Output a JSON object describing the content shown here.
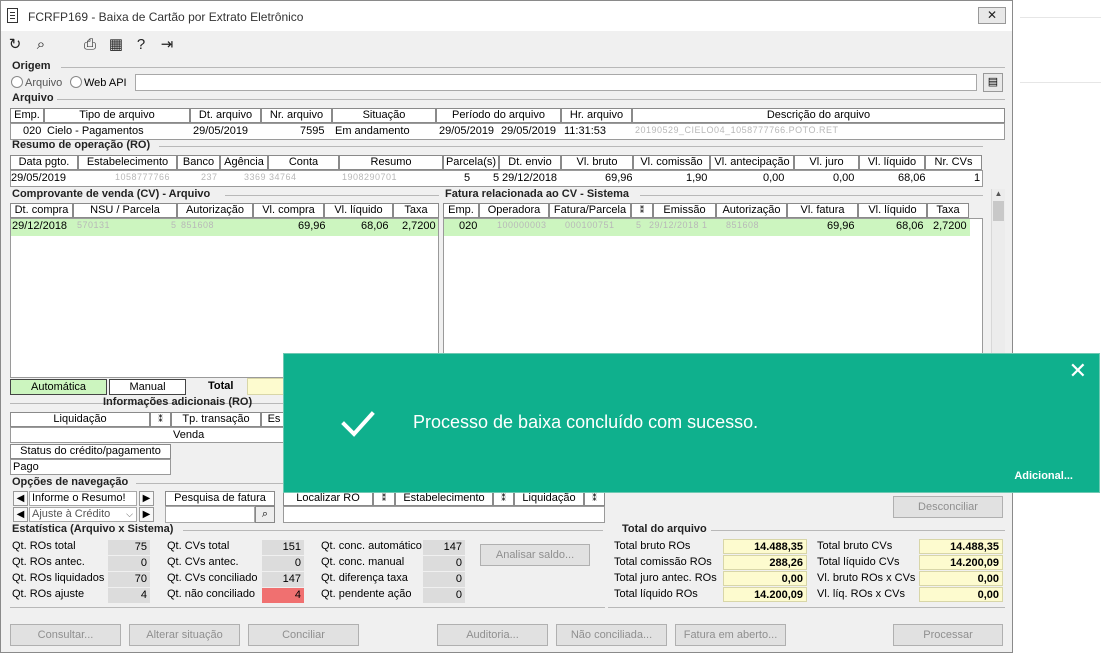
{
  "window": {
    "title": "FCRFP169 - Baixa de Cartão por Extrato Eletrônico",
    "close_glyph": "✕"
  },
  "toolbar": {
    "icons": [
      "refresh-icon",
      "search-icon",
      "print-icon",
      "calendar-icon",
      "help-icon",
      "exit-icon"
    ],
    "glyphs": {
      "refresh": "↻",
      "search": "⌕",
      "print": "⎙",
      "calendar": "▦",
      "help": "?",
      "exit": "⇥"
    }
  },
  "origem": {
    "title": "Origem",
    "opt1": "Arquivo",
    "opt2": "Web API",
    "path": ""
  },
  "arquivo": {
    "title": "Arquivo",
    "headers": [
      "Emp.",
      "Tipo de arquivo",
      "Dt. arquivo",
      "Nr. arquivo",
      "Situação",
      "Período do arquivo",
      "Hr. arquivo",
      "Descrição do arquivo"
    ],
    "row": {
      "emp": "020",
      "tipo": "Cielo - Pagamentos",
      "dt": "29/05/2019",
      "nr": "7595",
      "situacao": "Em andamento",
      "periodo_ini": "29/05/2019",
      "periodo_fim": "29/05/2019",
      "hr": "11:31:53",
      "descricao": "20190529_CIELO04_1058777766.POTO.RET"
    }
  },
  "resumo": {
    "title": "Resumo de operação (RO)",
    "headers": [
      "Data pgto.",
      "Estabelecimento",
      "Banco",
      "Agência",
      "Conta",
      "Resumo",
      "Parcela(s)",
      "Dt. envio",
      "Vl. bruto",
      "Vl. comissão",
      "Vl. antecipação",
      "Vl. juro",
      "Vl. líquido",
      "Nr. CVs"
    ],
    "row": {
      "data": "29/05/2019",
      "estab": "1058777766",
      "banco": "237",
      "agencia": "3369",
      "conta": "34764",
      "resumo": "1908290701",
      "parc1": "5",
      "parc2": "5",
      "envio": "29/12/2018",
      "bruto": "69,96",
      "comissao": "1,90",
      "antecip": "0,00",
      "juro": "0,00",
      "liquido": "68,06",
      "ncvs": "1"
    }
  },
  "cv": {
    "title": "Comprovante de venda (CV) - Arquivo",
    "headers": [
      "Dt. compra",
      "NSU / Parcela",
      "Autorização",
      "Vl. compra",
      "Vl. líquido",
      "Taxa"
    ],
    "row": {
      "dt": "29/12/2018",
      "nsu": "570131",
      "parc": "5",
      "aut": "851608",
      "compra": "69,96",
      "liquido": "68,06",
      "taxa": "2,7200"
    }
  },
  "fatura": {
    "title": "Fatura relacionada ao CV - Sistema",
    "headers": [
      "Emp.",
      "Operadora",
      "Fatura/Parcela",
      "",
      "Emissão",
      "Autorização",
      "Vl. fatura",
      "Vl. líquido",
      "Taxa"
    ],
    "row": {
      "emp": "020",
      "operadora": "100000003",
      "fatura": "000100751",
      "parc": "5",
      "emissao": "29/12/2018 1",
      "aut": "851608",
      "vfatura": "69,96",
      "liquido": "68,06",
      "taxa": "2,7200"
    }
  },
  "legend": {
    "auto": "Automática",
    "manual": "Manual",
    "total": "Total"
  },
  "info": {
    "title": "Informações adicionais (RO)",
    "liquidacao": "Liquidação",
    "tp_transacao": "Tp. transação",
    "es": "Es",
    "tp_value": "Venda",
    "status_title": "Status do crédito/pagamento",
    "status_value": "Pago"
  },
  "nav": {
    "title": "Opções de navegação",
    "informe": "Informe o Resumo!",
    "ajuste": "Ajuste à Crédito",
    "pesquisa": "Pesquisa de fatura",
    "localizar": "Localizar RO",
    "estabelecimento": "Estabelecimento",
    "liquidacao": "Liquidação"
  },
  "desconciliar": "Desconciliar",
  "estatistica": {
    "title": "Estatística (Arquivo x Sistema)",
    "col1": [
      {
        "label": "Qt. ROs total",
        "value": "75"
      },
      {
        "label": "Qt. ROs antec.",
        "value": "0"
      },
      {
        "label": "Qt. ROs liquidados",
        "value": "70"
      },
      {
        "label": "Qt. ROs ajuste",
        "value": "4"
      }
    ],
    "col2": [
      {
        "label": "Qt. CVs total",
        "value": "151"
      },
      {
        "label": "Qt. CVs antec.",
        "value": "0"
      },
      {
        "label": "Qt. CVs conciliado",
        "value": "147"
      },
      {
        "label": "Qt. não conciliado",
        "value": "4"
      }
    ],
    "col3": [
      {
        "label": "Qt. conc. automático",
        "value": "147"
      },
      {
        "label": "Qt. conc. manual",
        "value": "0"
      },
      {
        "label": "Qt. diferença taxa",
        "value": "0"
      },
      {
        "label": "Qt. pendente ação",
        "value": "0"
      }
    ],
    "analisar": "Analisar saldo..."
  },
  "total": {
    "title": "Total do arquivo",
    "left": [
      {
        "label": "Total bruto ROs",
        "value": "14.488,35"
      },
      {
        "label": "Total comissão ROs",
        "value": "288,26"
      },
      {
        "label": "Total juro antec. ROs",
        "value": "0,00"
      },
      {
        "label": "Total líquido ROs",
        "value": "14.200,09"
      }
    ],
    "right": [
      {
        "label": "Total bruto CVs",
        "value": "14.488,35"
      },
      {
        "label": "Total líquido CVs",
        "value": "14.200,09"
      },
      {
        "label": "Vl. bruto ROs x CVs",
        "value": "0,00"
      },
      {
        "label": "Vl. líq. ROs x CVs",
        "value": "0,00"
      }
    ]
  },
  "buttons": {
    "consultar": "Consultar...",
    "alterar": "Alterar situação",
    "conciliar": "Conciliar",
    "auditoria": "Auditoria...",
    "nao_conciliada": "Não conciliada...",
    "fatura_aberto": "Fatura em aberto...",
    "processar": "Processar"
  },
  "toast": {
    "message": "Processo de baixa concluído com sucesso.",
    "more": "Adicional...",
    "close": "✕"
  },
  "colors": {
    "toast": "#0fb08d",
    "green_row": "#ccf5bf",
    "red_value": "#f07070",
    "yellow_total": "#fdfbcf"
  }
}
